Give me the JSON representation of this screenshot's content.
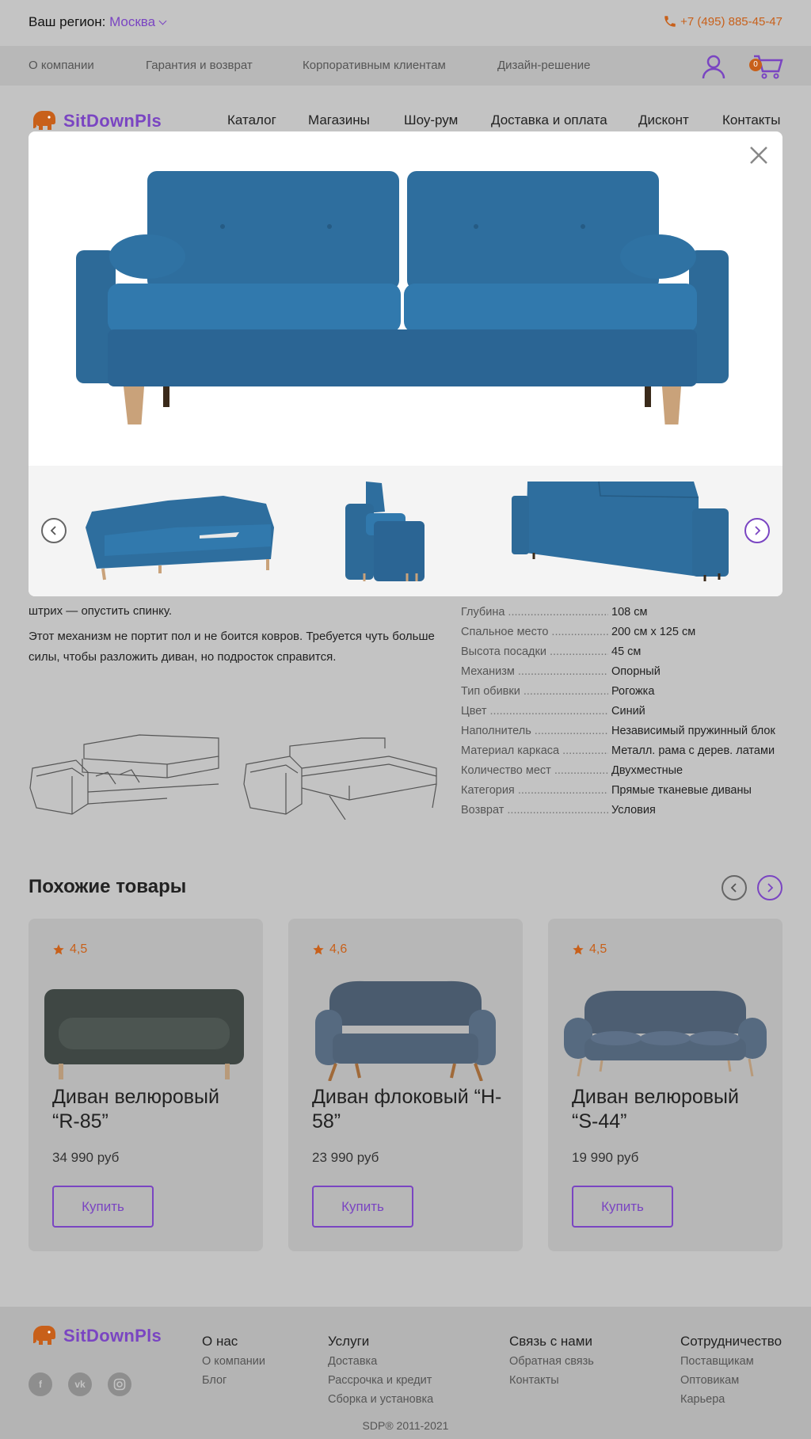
{
  "header": {
    "region_label": "Ваш регион:",
    "region_city": "Москва",
    "phone": "+7 (495) 885-45-47"
  },
  "subnav": {
    "items": [
      "О компании",
      "Гарантия и возврат",
      "Корпоративным клиентам",
      "Дизайн-решение"
    ],
    "cart_count": "0"
  },
  "brand": {
    "name": "SitDownPls"
  },
  "mainnav": {
    "items": [
      "Каталог",
      "Магазины",
      "Шоу-рум",
      "Доставка и оплата",
      "Дисконт",
      "Контакты"
    ]
  },
  "description": {
    "p1": "штрих — опустить спинку.",
    "p2": "Этот механизм не портит пол и не боится ковров. Требуется чуть больше силы, чтобы разложить диван, но подросток справится."
  },
  "specs": [
    {
      "k": "Глубина",
      "v": "108 см"
    },
    {
      "k": "Спальное место",
      "v": "200 см х 125 см"
    },
    {
      "k": "Высота посадки",
      "v": "45 см"
    },
    {
      "k": "Механизм",
      "v": "Опорный"
    },
    {
      "k": "Тип обивки",
      "v": "Рогожка"
    },
    {
      "k": "Цвет",
      "v": "Синий"
    },
    {
      "k": "Наполнитель",
      "v": "Независимый пружинный блок"
    },
    {
      "k": "Материал каркаса",
      "v": "Металл. рама с дерев. латами"
    },
    {
      "k": "Количество мест",
      "v": "Двухместные"
    },
    {
      "k": "Категория",
      "v": "Прямые тканевые диваны"
    },
    {
      "k": "Возврат",
      "v": "Условия"
    }
  ],
  "similar": {
    "title": "Похожие товары",
    "buy_label": "Купить",
    "products": [
      {
        "rating": "4,5",
        "name": "Диван велюровый “R-85”",
        "price": "34 990 руб",
        "color": "#3f4744"
      },
      {
        "rating": "4,6",
        "name": "Диван флоковый “H-58”",
        "price": "23 990 руб",
        "color": "#4a5b6e"
      },
      {
        "rating": "4,5",
        "name": "Диван велюровый “S-44”",
        "price": "19 990 руб",
        "color": "#4d5e72"
      }
    ]
  },
  "footer": {
    "columns": [
      {
        "title": "О нас",
        "links": [
          "О компании",
          "Блог"
        ]
      },
      {
        "title": "Услуги",
        "links": [
          "Доставка",
          "Рассрочка и кредит",
          "Сборка и установка"
        ]
      },
      {
        "title": "Связь с нами",
        "links": [
          "Обратная связь",
          "Контакты"
        ]
      },
      {
        "title": "Сотрудничество",
        "links": [
          "Поставщикам",
          "Оптовикам",
          "Карьера"
        ]
      }
    ],
    "copyright": "SDP®   2011-2021"
  },
  "colors": {
    "accent": "#7a45c2",
    "orange": "#c8601a",
    "sofa_blue": "#2e6e9e"
  },
  "icons": [
    "phone-icon",
    "user-icon",
    "cart-icon",
    "close-icon",
    "star-icon",
    "facebook-icon",
    "vk-icon",
    "instagram-icon"
  ]
}
